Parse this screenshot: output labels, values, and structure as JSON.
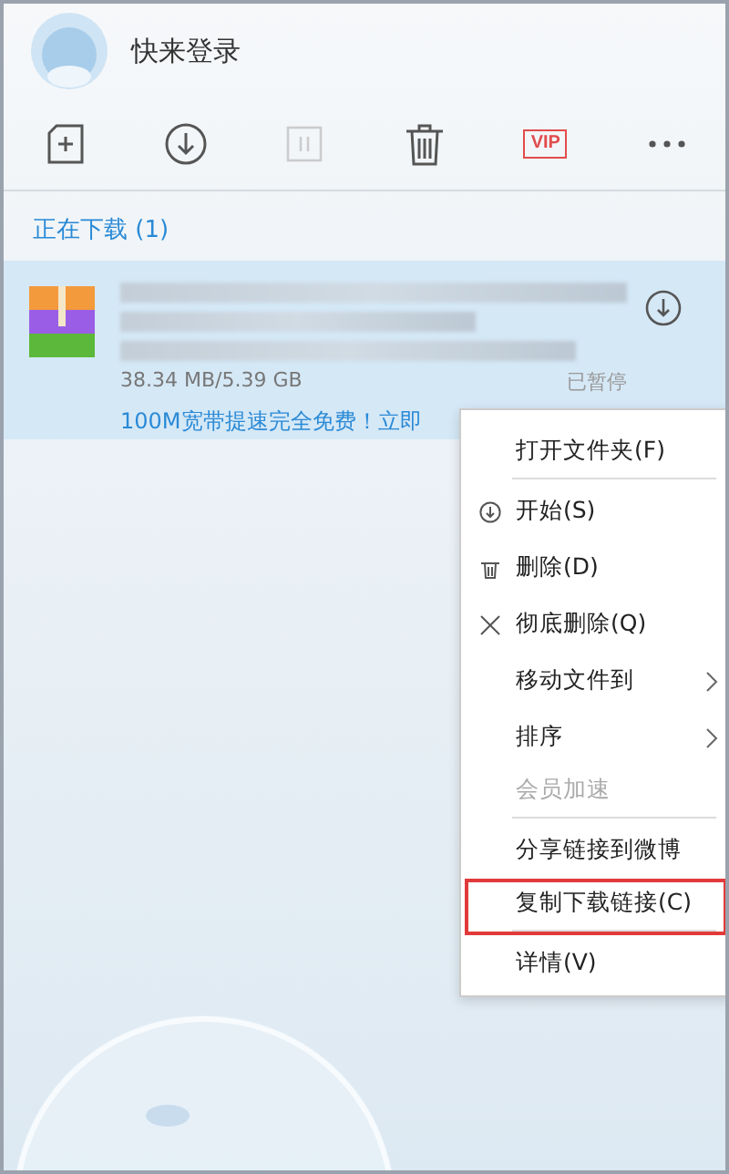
{
  "header": {
    "title": "快来登录"
  },
  "toolbar": [
    {
      "kind": "new"
    },
    {
      "kind": "download"
    },
    {
      "kind": "pause",
      "disabled": true
    },
    {
      "kind": "delete"
    },
    {
      "kind": "vip",
      "label": "VIP"
    },
    {
      "kind": "more"
    }
  ],
  "section": {
    "title": "正在下载 (1)"
  },
  "download": {
    "size": "38.34 MB/5.39 GB",
    "status": "已暂停",
    "promo": "100M宽带提速完全免费！立即",
    "selected": true
  },
  "context_menu": [
    {
      "label": "打开文件夹(F)",
      "kind": "plain",
      "disabled": false,
      "submenu": false,
      "highlighted": false,
      "separator_after": true
    },
    {
      "label": "开始(S)",
      "kind": "start",
      "disabled": false,
      "submenu": false,
      "highlighted": false,
      "separator_after": false
    },
    {
      "label": "删除(D)",
      "kind": "delete",
      "disabled": false,
      "submenu": false,
      "highlighted": false,
      "separator_after": false
    },
    {
      "label": "彻底删除(Q)",
      "kind": "purge",
      "disabled": false,
      "submenu": false,
      "highlighted": false,
      "separator_after": false
    },
    {
      "label": "移动文件到",
      "kind": "plain",
      "disabled": false,
      "submenu": true,
      "highlighted": false,
      "separator_after": false
    },
    {
      "label": "排序",
      "kind": "plain",
      "disabled": false,
      "submenu": true,
      "highlighted": false,
      "separator_after": false
    },
    {
      "label": "会员加速",
      "kind": "plain",
      "disabled": true,
      "submenu": false,
      "highlighted": false,
      "separator_after": true
    },
    {
      "label": "分享链接到微博",
      "kind": "plain",
      "disabled": false,
      "submenu": false,
      "highlighted": false,
      "separator_after": false
    },
    {
      "label": "复制下载链接(C)",
      "kind": "plain",
      "disabled": false,
      "submenu": false,
      "highlighted": true,
      "separator_after": true
    },
    {
      "label": "详情(V)",
      "kind": "plain",
      "disabled": false,
      "submenu": false,
      "highlighted": false,
      "separator_after": false
    }
  ]
}
